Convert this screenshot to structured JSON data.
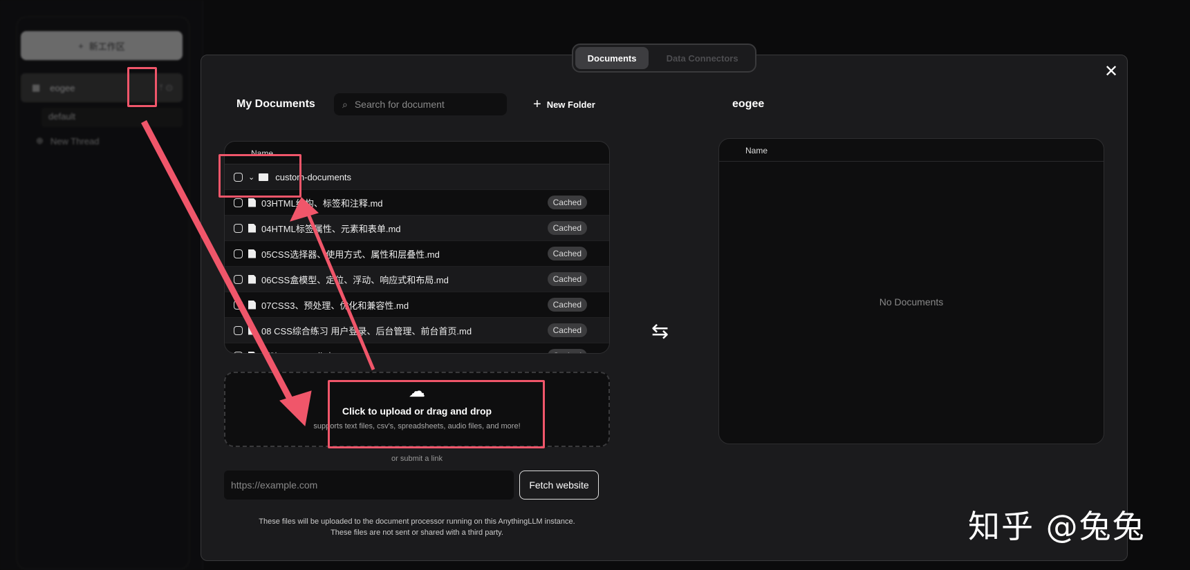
{
  "sidebar": {
    "new_workspace": "新工作区",
    "workspace": "eogee",
    "thread": "default",
    "new_thread": "New Thread"
  },
  "tabs": [
    {
      "label": "Documents",
      "active": true
    },
    {
      "label": "Data Connectors",
      "active": false
    }
  ],
  "left": {
    "title": "My Documents",
    "search_placeholder": "Search for document",
    "new_folder": "New Folder",
    "column": "Name",
    "folder": "custom-documents",
    "files": [
      {
        "name": "03HTML结构、标签和注释.md",
        "status": "Cached"
      },
      {
        "name": "04HTML标签属性、元素和表单.md",
        "status": "Cached"
      },
      {
        "name": "05CSS选择器、使用方式、属性和层叠性.md",
        "status": "Cached"
      },
      {
        "name": "06CSS盒模型、定位、浮动、响应式和布局.md",
        "status": "Cached"
      },
      {
        "name": "07CSS3、预处理、优化和兼容性.md",
        "status": "Cached"
      },
      {
        "name": "08 CSS综合练习 用户登录、后台管理、前台首页.md",
        "status": "Cached"
      },
      {
        "name": "新建 XLSX 工作表.csv",
        "status": "Cached"
      }
    ]
  },
  "right": {
    "title": "eogee",
    "column": "Name",
    "empty": "No Documents"
  },
  "upload": {
    "title": "Click to upload or drag and drop",
    "subtitle": "supports text files, csv's, spreadsheets, audio files, and more!",
    "or_link": "or submit a link",
    "url_placeholder": "https://example.com",
    "fetch": "Fetch website",
    "note1": "These files will be uploaded to the document processor running on this AnythingLLM instance.",
    "note2": "These files are not sent or shared with a third party."
  },
  "watermark": "知乎 @兔兔",
  "colors": {
    "accent_red": "#f0566a",
    "modal_bg": "#1b1b1d"
  }
}
